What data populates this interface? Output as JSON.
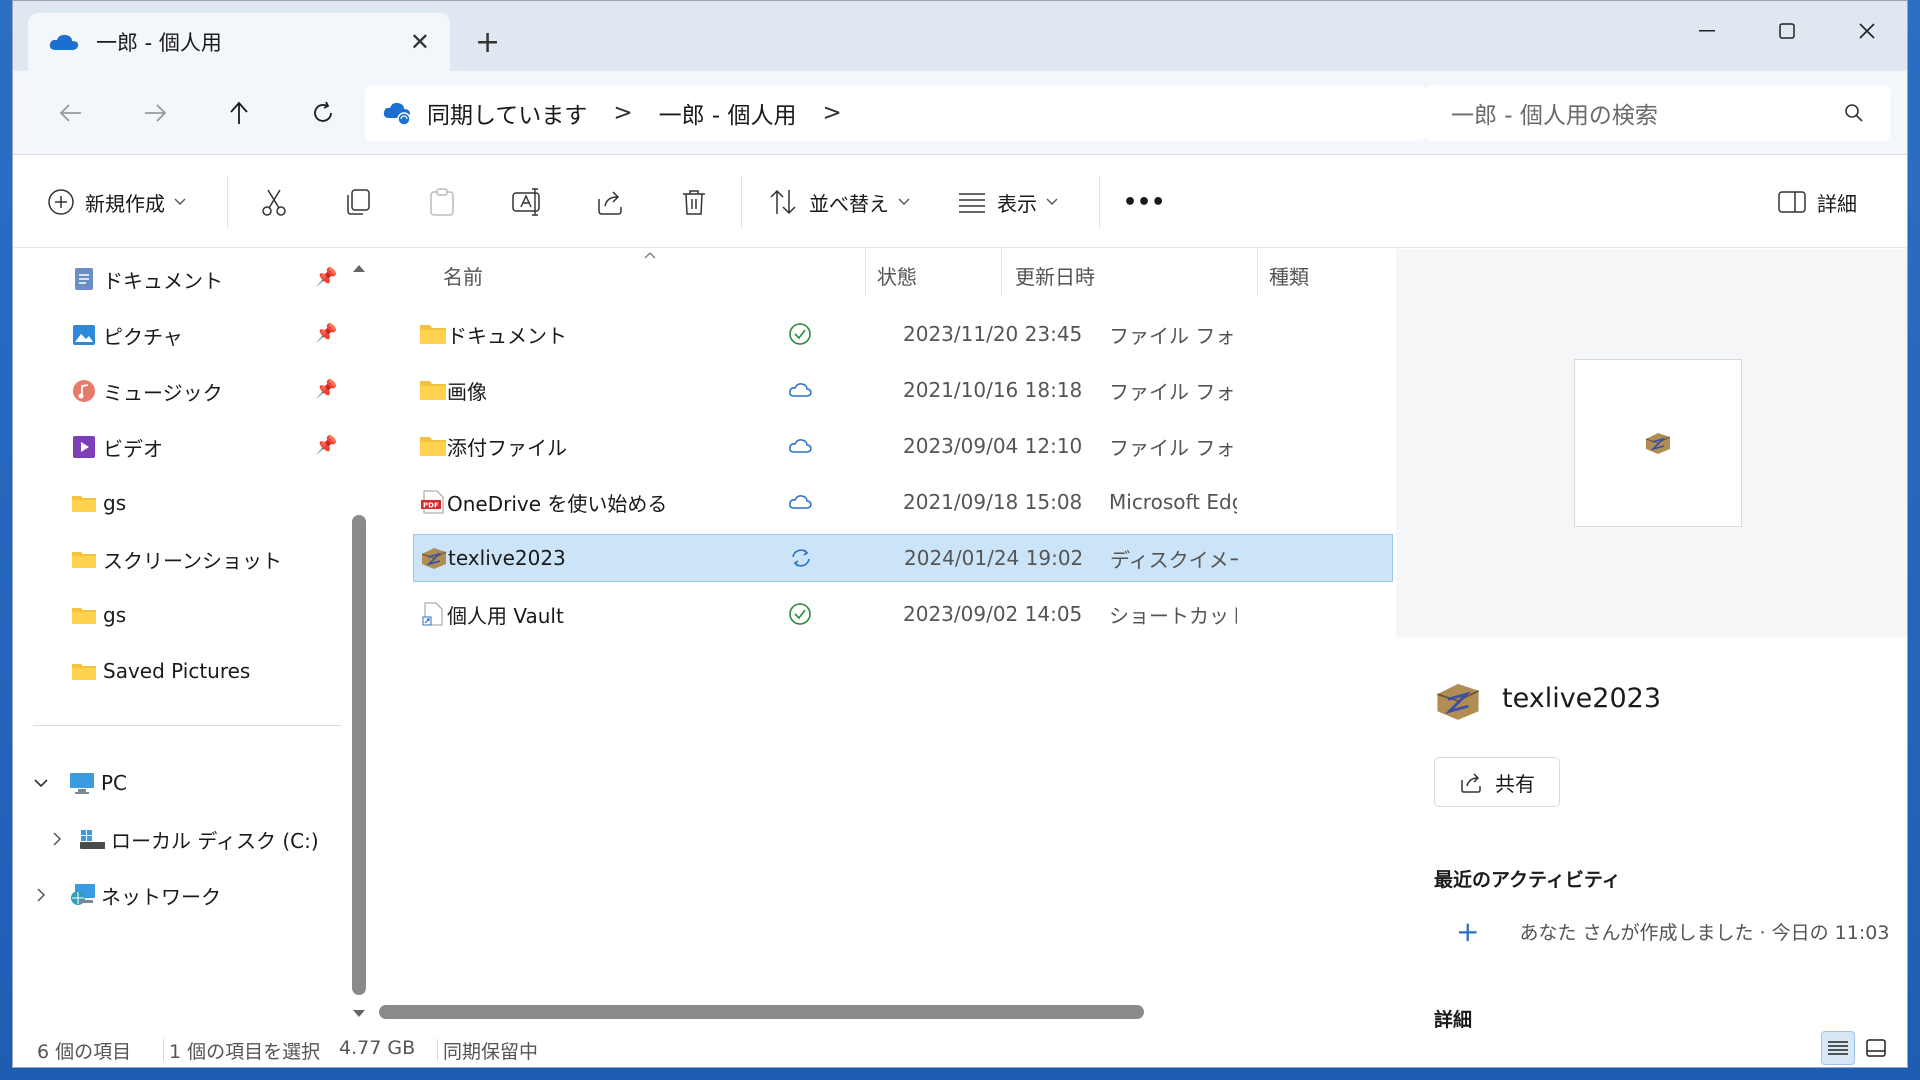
{
  "window": {
    "tab_title": "一郎 - 個人用",
    "new_tab": "+",
    "close_tab": "✕"
  },
  "address": {
    "crumbs": [
      "同期しています",
      "一郎 - 個人用"
    ],
    "separator": ">",
    "search_placeholder": "一郎 - 個人用の検索"
  },
  "toolbar": {
    "new_label": "新規作成",
    "sort_label": "並べ替え",
    "view_label": "表示",
    "more_label": "•••",
    "details_label": "詳細"
  },
  "sidebar": {
    "quick": [
      {
        "label": "ドキュメント",
        "icon": "documents-icon",
        "pinned": true
      },
      {
        "label": "ピクチャ",
        "icon": "pictures-icon",
        "pinned": true
      },
      {
        "label": "ミュージック",
        "icon": "music-icon",
        "pinned": true
      },
      {
        "label": "ビデオ",
        "icon": "videos-icon",
        "pinned": true
      },
      {
        "label": "gs",
        "icon": "folder-icon",
        "pinned": false
      },
      {
        "label": "スクリーンショット",
        "icon": "folder-icon",
        "pinned": false
      },
      {
        "label": "gs",
        "icon": "folder-icon",
        "pinned": false
      },
      {
        "label": "Saved Pictures",
        "icon": "folder-icon",
        "pinned": false
      }
    ],
    "pc_label": "PC",
    "drive_label": "ローカル ディスク (C:)",
    "network_label": "ネットワーク"
  },
  "columns": {
    "name": "名前",
    "status": "状態",
    "modified": "更新日時",
    "type": "種類"
  },
  "files": [
    {
      "name": "ドキュメント",
      "icon": "folder-icon",
      "status": "synced",
      "date": "2023/11/20 23:45",
      "type": "ファイル フォルダー",
      "selected": false
    },
    {
      "name": "画像",
      "icon": "folder-icon",
      "status": "cloud",
      "date": "2021/10/16 18:18",
      "type": "ファイル フォルダー",
      "selected": false
    },
    {
      "name": "添付ファイル",
      "icon": "folder-icon",
      "status": "cloud",
      "date": "2023/09/04 12:10",
      "type": "ファイル フォルダー",
      "selected": false
    },
    {
      "name": "OneDrive を使い始める",
      "icon": "pdf-icon",
      "status": "cloud",
      "date": "2021/09/18 15:08",
      "type": "Microsoft Edge",
      "selected": false
    },
    {
      "name": "texlive2023",
      "icon": "disk-image-icon",
      "status": "syncing",
      "date": "2024/01/24 19:02",
      "type": "ディスクイメージ",
      "selected": true
    },
    {
      "name": "個人用 Vault",
      "icon": "shortcut-icon",
      "status": "synced",
      "date": "2023/09/02 14:05",
      "type": "ショートカット",
      "selected": false
    }
  ],
  "details": {
    "title": "texlive2023",
    "share_label": "共有",
    "activity_heading": "最近のアクティビティ",
    "activity_text": "あなた さんが作成しました · 今日の 11:03",
    "details_heading": "詳細"
  },
  "status": {
    "count": "6 個の項目",
    "selected": "1 個の項目を選択",
    "size": "4.77 GB",
    "sync": "同期保留中"
  },
  "colors": {
    "accent": "#2a6fc7",
    "selection": "#cce4f7",
    "synced": "#2e8b3d",
    "folder": "#f5c33b"
  }
}
